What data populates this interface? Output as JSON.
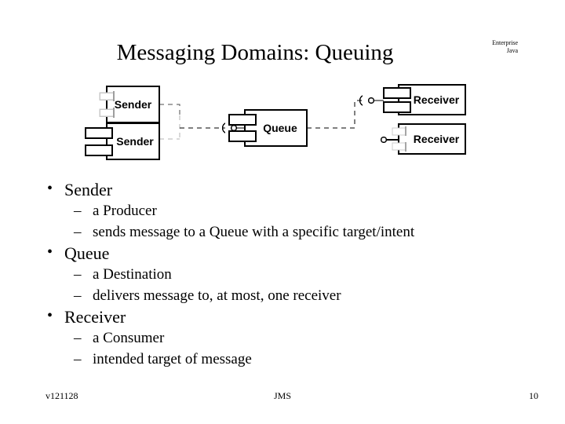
{
  "slide": {
    "title": "Messaging Domains: Queuing",
    "logo": {
      "line1": "Enterprise",
      "line2": "Java"
    }
  },
  "diagram": {
    "components": [
      {
        "name": "sender-top",
        "label": "Sender"
      },
      {
        "name": "sender-bottom",
        "label": "Sender"
      },
      {
        "name": "queue",
        "label": "Queue"
      },
      {
        "name": "receiver-top",
        "label": "Receiver"
      },
      {
        "name": "receiver-bottom",
        "label": "Receiver"
      }
    ]
  },
  "bullets": [
    {
      "level": 1,
      "marker": "•",
      "text": "Sender"
    },
    {
      "level": 2,
      "marker": "–",
      "text": "a Producer"
    },
    {
      "level": 2,
      "marker": "–",
      "text": "sends message to a Queue with a specific target/intent"
    },
    {
      "level": 1,
      "marker": "•",
      "text": "Queue"
    },
    {
      "level": 2,
      "marker": "–",
      "text": "a Destination"
    },
    {
      "level": 2,
      "marker": "–",
      "text": "delivers message to, at most, one receiver"
    },
    {
      "level": 1,
      "marker": "•",
      "text": "Receiver"
    },
    {
      "level": 2,
      "marker": "–",
      "text": "a Consumer"
    },
    {
      "level": 2,
      "marker": "–",
      "text": "intended target of message"
    }
  ],
  "footer": {
    "version": "v121128",
    "topic": "JMS",
    "page_number": "10"
  },
  "colors": {
    "text": "#000000",
    "background": "#ffffff",
    "stroke": "#000000",
    "faded_stroke": "#b3b3b3"
  }
}
